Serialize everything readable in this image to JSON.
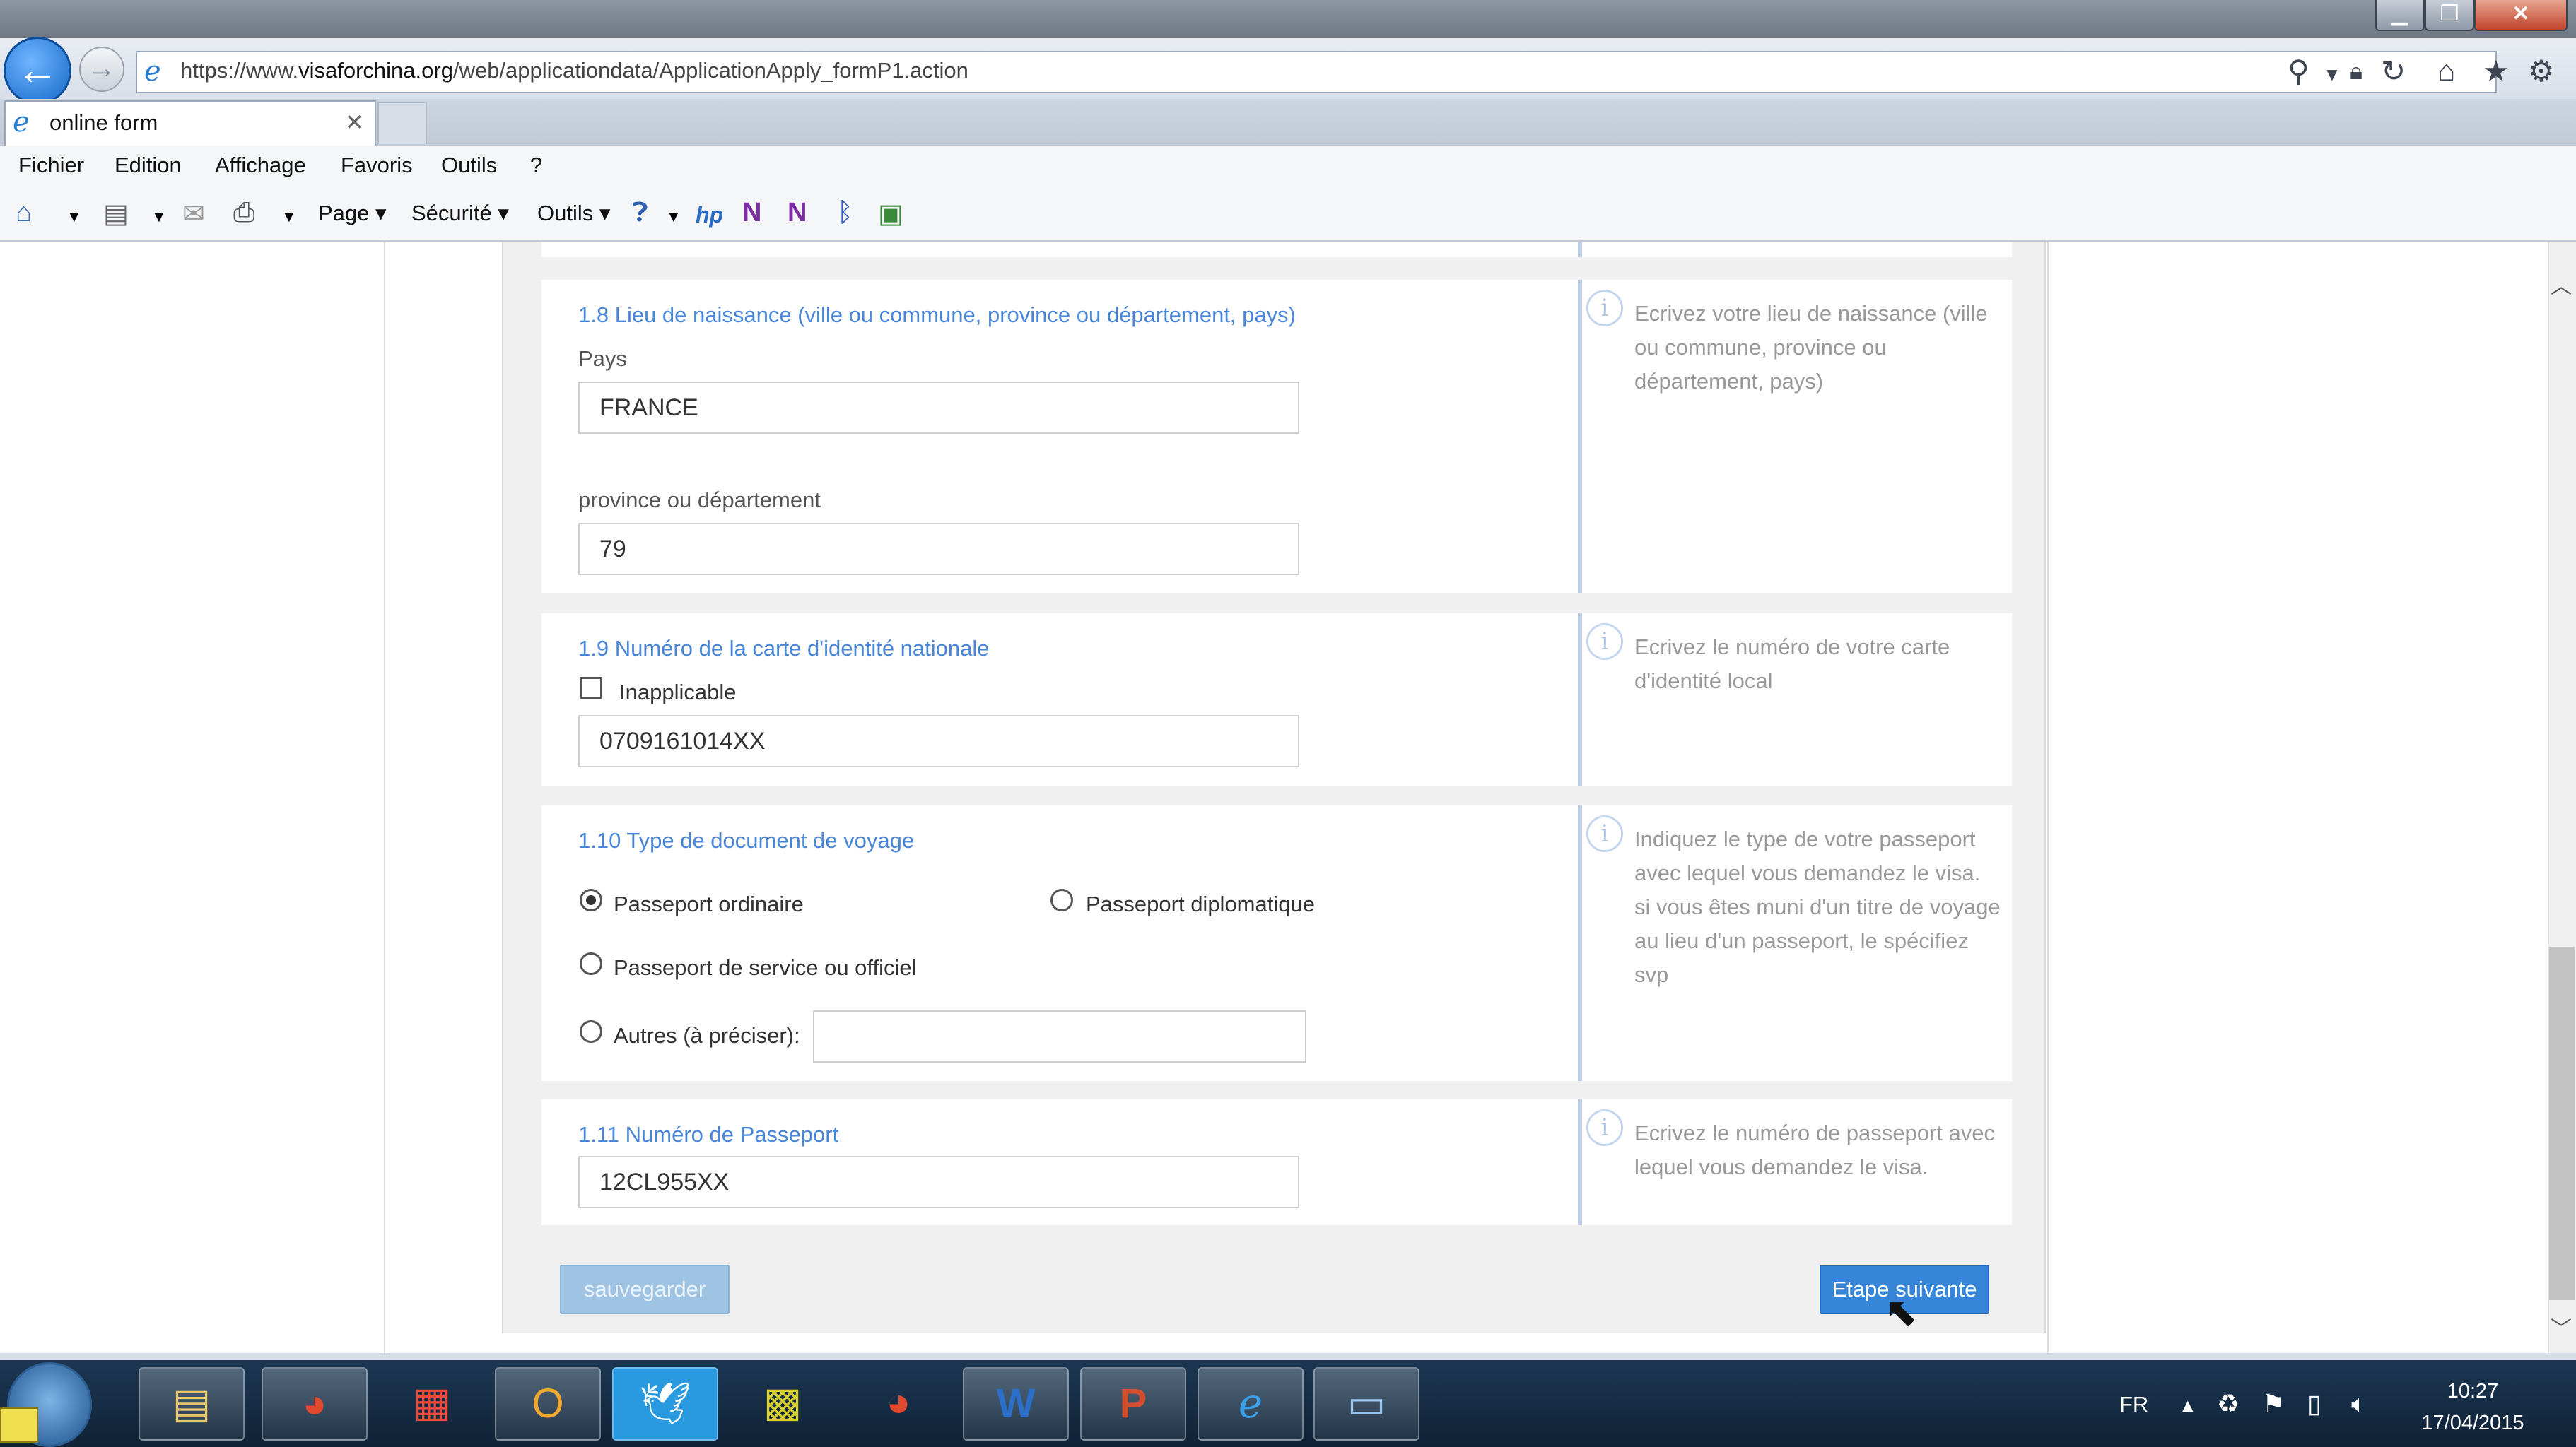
{
  "browser": {
    "url_prefix": "https://www.",
    "url_domain": "visaforchina.org",
    "url_path": "/web/applicationdata/ApplicationApply_formP1.action",
    "tab_title": "online form",
    "window_controls": {
      "minimize": "▁",
      "maximize": "❐",
      "close": "✕"
    }
  },
  "menu": {
    "items": [
      "Fichier",
      "Edition",
      "Affichage",
      "Favoris",
      "Outils",
      "?"
    ]
  },
  "commandbar": {
    "page": "Page ▾",
    "security": "Sécurité ▾",
    "tools": "Outils ▾"
  },
  "form": {
    "top_card": {},
    "q1_8": {
      "title": "1.8 Lieu de naissance (ville ou commune, province ou département, pays)",
      "country_label": "Pays",
      "country_value": "FRANCE",
      "province_label": "province ou département",
      "province_value": "79",
      "help": "Ecrivez votre lieu de naissance (ville ou commune, province ou département, pays)"
    },
    "q1_9": {
      "title": "1.9 Numéro de la carte d'identité nationale",
      "inapplicable_label": "Inapplicable",
      "id_value": "0709161014XX",
      "help": "Ecrivez le numéro de votre carte d'identité local"
    },
    "q1_10": {
      "title": "1.10 Type de document de voyage",
      "options": {
        "ordinary": "Passeport ordinaire",
        "diplomatic": "Passeport diplomatique",
        "service": "Passeport de service ou officiel",
        "other": "Autres (à préciser):"
      },
      "selected": "ordinary",
      "help": "Indiquez le type de votre passeport avec lequel vous demandez le visa. si vous êtes muni d'un titre de voyage au lieu d'un passeport, le spécifiez svp"
    },
    "q1_11": {
      "title": "1.11 Numéro de Passeport",
      "passport_value": "12CL955XX",
      "help": "Ecrivez le numéro de passeport avec lequel vous demandez le visa."
    },
    "buttons": {
      "save": "sauvegarder",
      "next": "Etape suivante"
    }
  },
  "taskbar": {
    "language": "FR",
    "time": "10:27",
    "date": "17/04/2015"
  }
}
